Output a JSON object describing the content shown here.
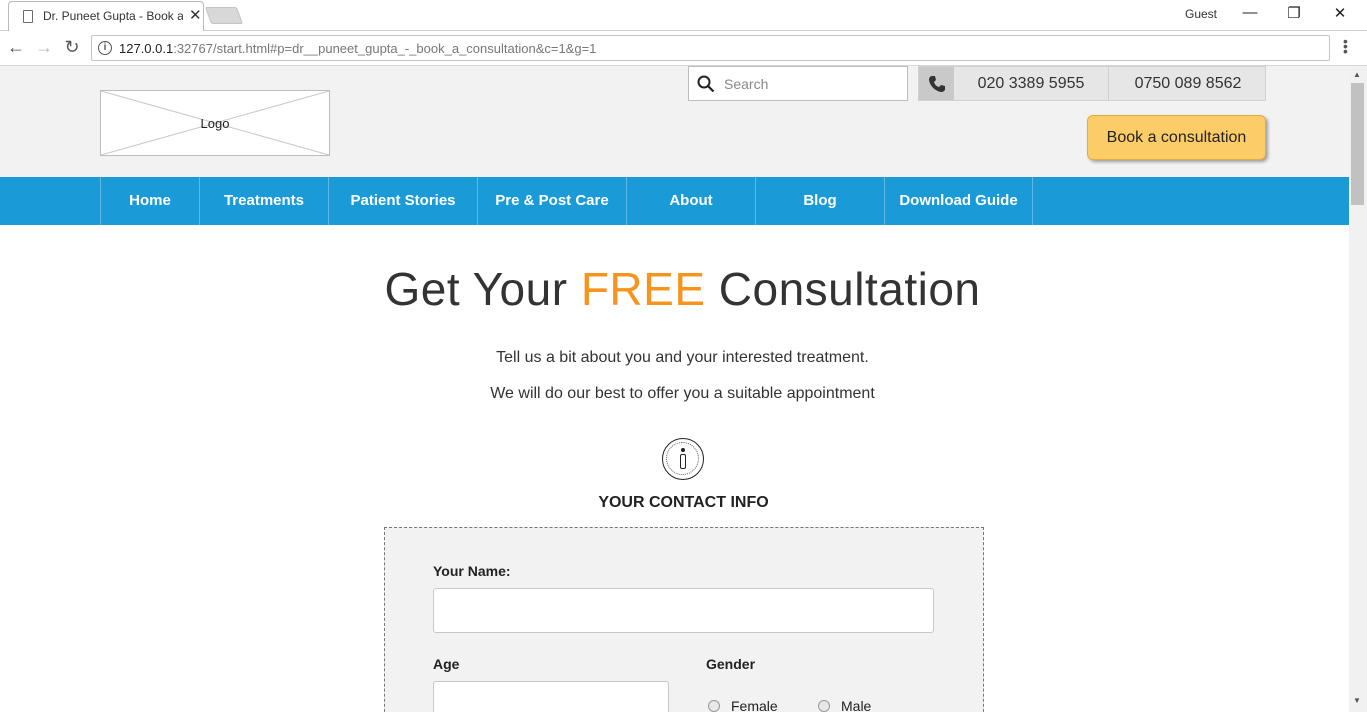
{
  "browser": {
    "tab_title": "Dr. Puneet Gupta - Book a consultation",
    "profile": "Guest",
    "url_host": "127.0.0.1",
    "url_rest": ":32767/start.html#p=dr__puneet_gupta_-_book_a_consultation&c=1&g=1"
  },
  "header": {
    "logo_text": "Logo",
    "search_placeholder": "Search",
    "phone1": "020 3389 5955",
    "phone2": "0750 089 8562",
    "cta": "Book a consultation"
  },
  "nav": {
    "items": [
      {
        "label": "Home"
      },
      {
        "label": "Treatments"
      },
      {
        "label": "Patient Stories"
      },
      {
        "label": "Pre & Post Care"
      },
      {
        "label": "About"
      },
      {
        "label": "Blog"
      },
      {
        "label": "Download Guide"
      }
    ]
  },
  "main": {
    "title_before": "Get Your ",
    "title_highlight": "FREE",
    "title_after": " Consultation",
    "intro1": "Tell us a bit about you and your interested treatment.",
    "intro2": "We will do our best to offer you a suitable appointment",
    "section_title": "YOUR CONTACT INFO"
  },
  "form": {
    "name_label": "Your Name:",
    "age_label": "Age",
    "gender_label": "Gender",
    "gender_options": [
      {
        "label": "Female"
      },
      {
        "label": "Male"
      }
    ]
  },
  "colors": {
    "nav_bg": "#1a9bd7",
    "accent": "#f7941d",
    "cta_bg": "#fccc66"
  }
}
